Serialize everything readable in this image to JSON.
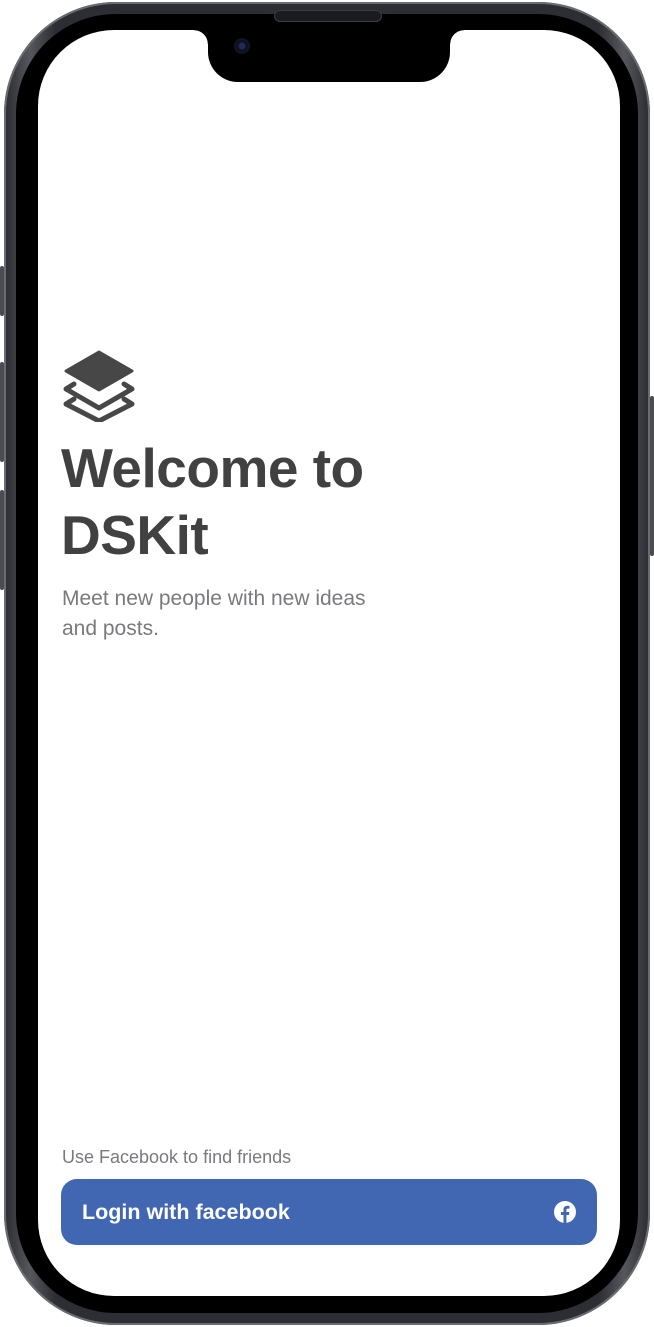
{
  "welcome": {
    "logo_icon": "layers-icon",
    "title_line1": "Welcome to",
    "title_line2": "DSKit",
    "subtitle": "Meet new people with new ideas and posts."
  },
  "login": {
    "helper_text": "Use Facebook to find friends",
    "button_label": "Login with facebook",
    "button_icon": "facebook-icon"
  },
  "colors": {
    "text_primary": "#414141",
    "text_secondary": "#7a7a7e",
    "facebook_blue": "#4267b2",
    "background": "#ffffff"
  }
}
